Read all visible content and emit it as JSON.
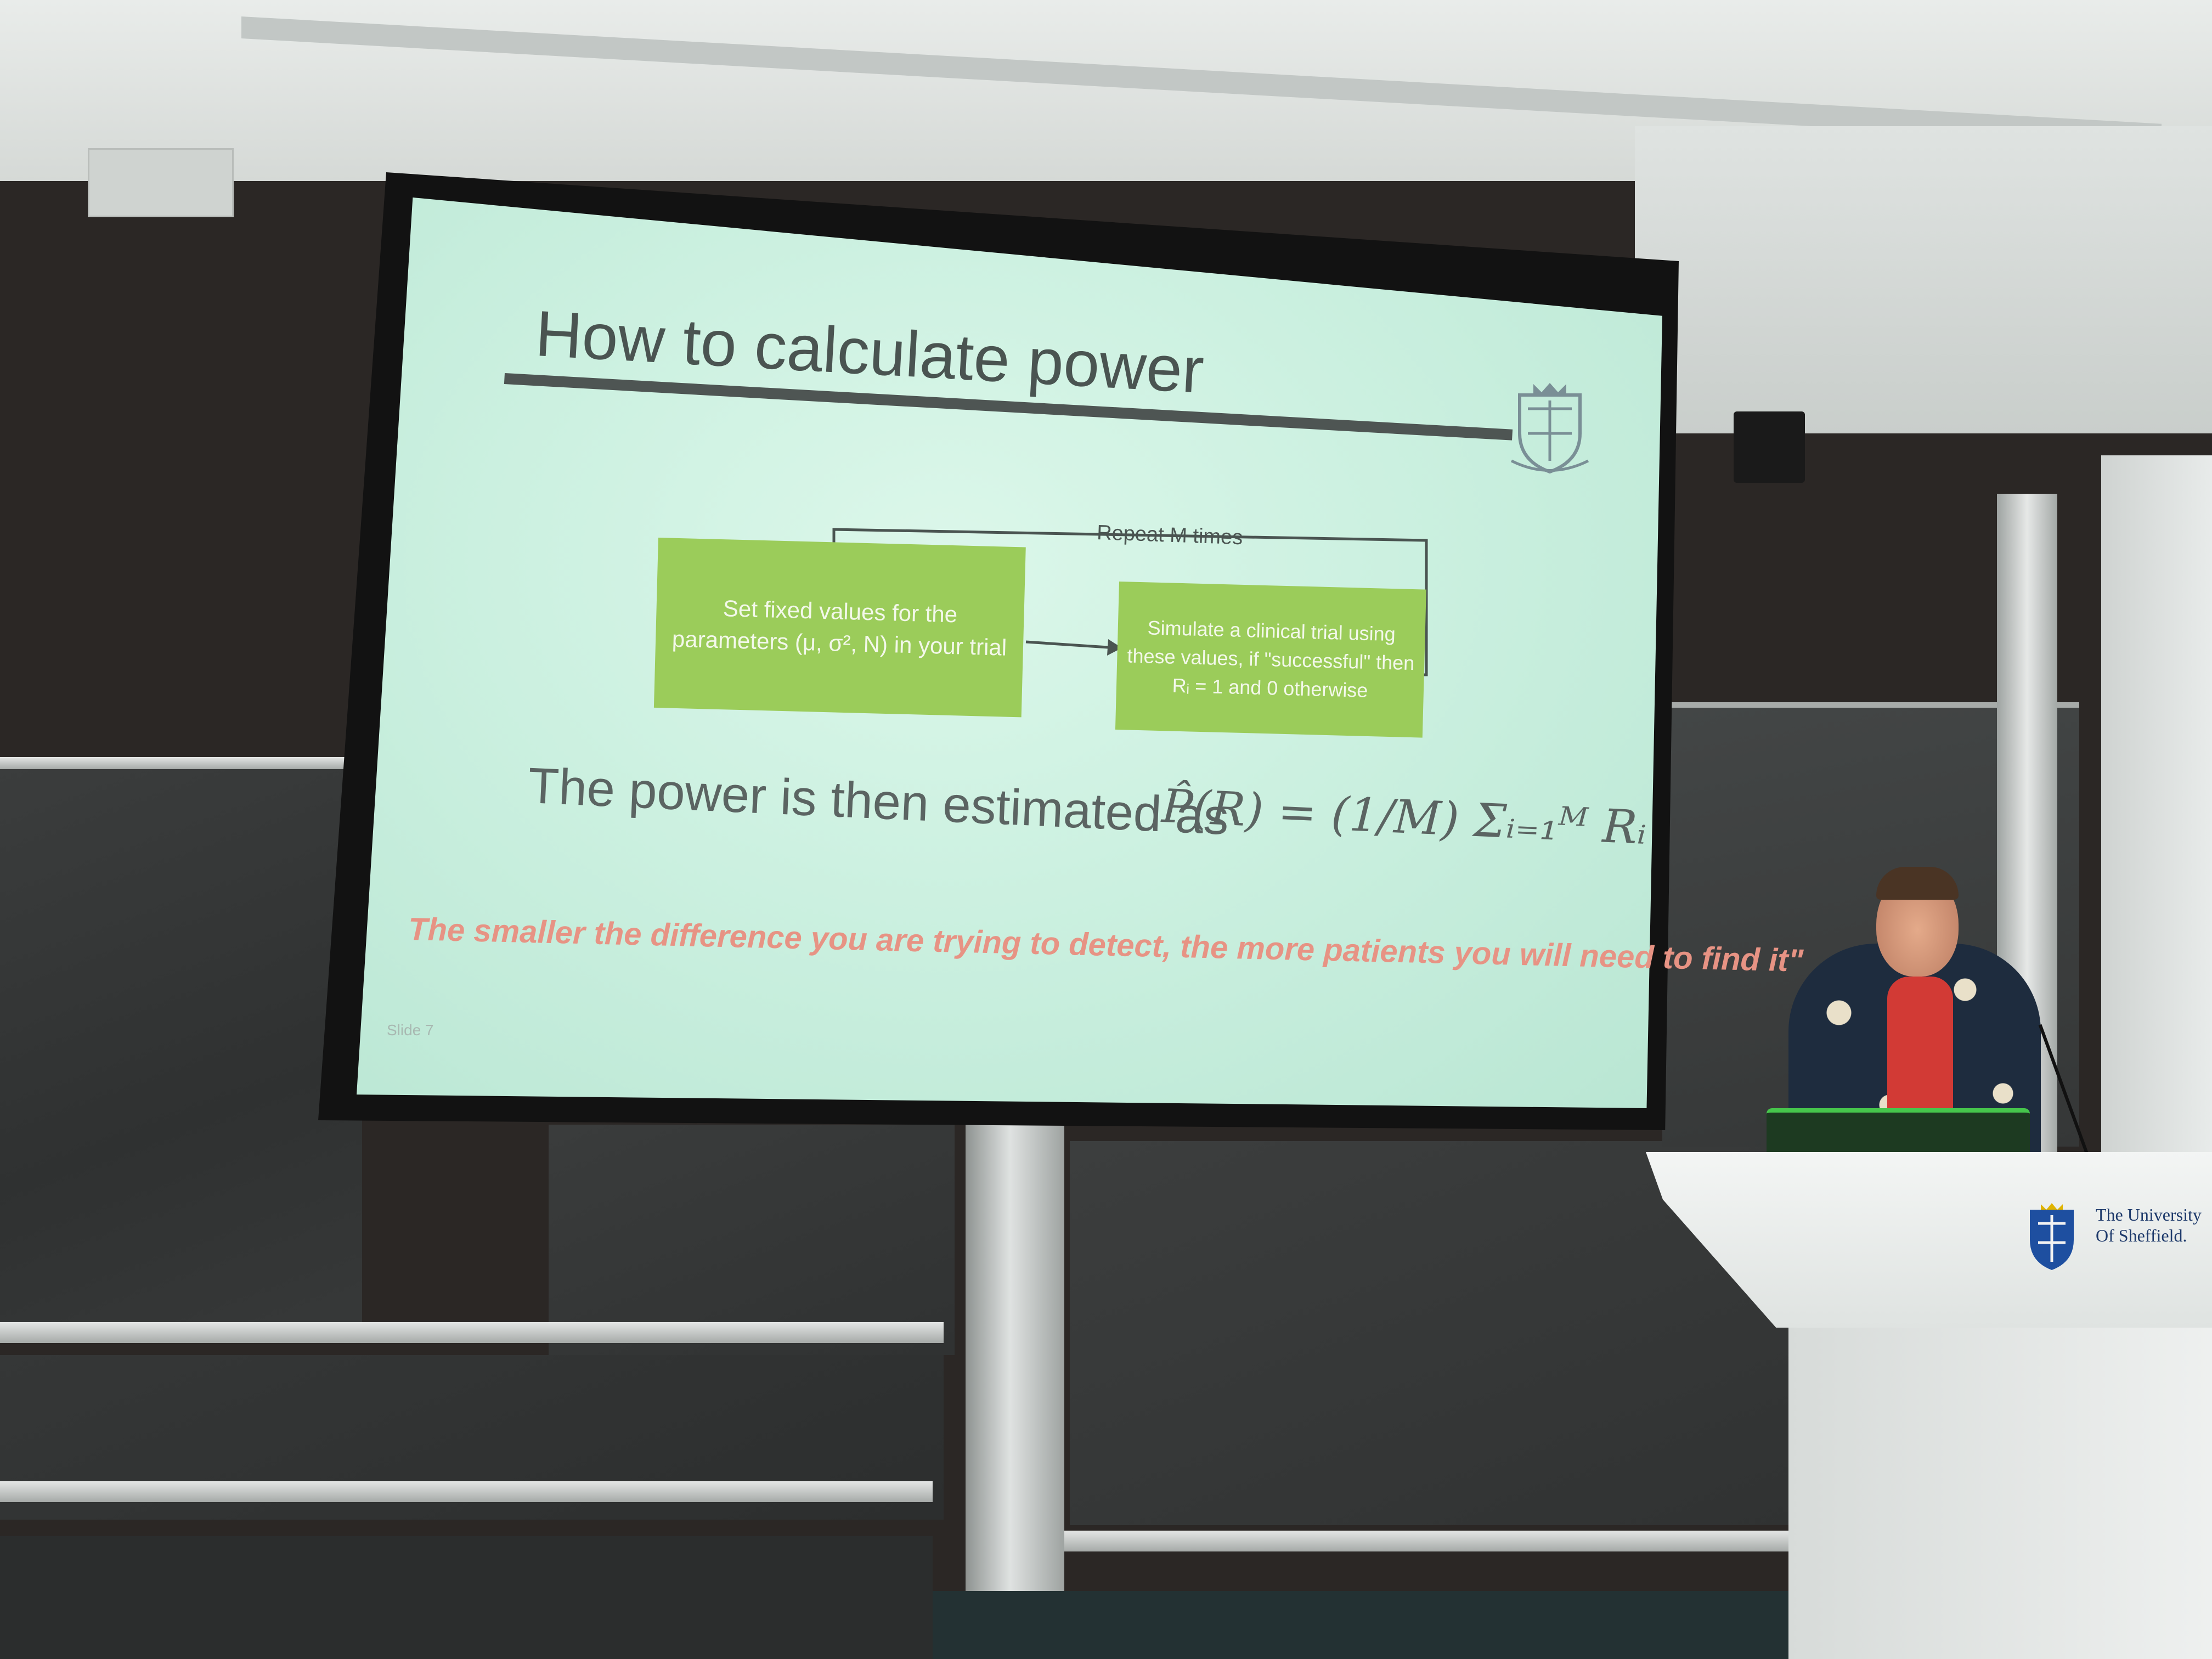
{
  "slide": {
    "title": "How to calculate power",
    "repeat_label": "Repeat M times",
    "box_left": "Set fixed values for the parameters (μ, σ², N) in your trial",
    "box_right": "Simulate a clinical trial using these values, if \"successful\" then Rᵢ = 1 and 0 otherwise",
    "power_text": "The power is then estimated as",
    "formula": "P̂(R) = (1/M) Σᵢ₌₁ᴹ Rᵢ",
    "quote": "The smaller the difference you are trying to detect, the more patients you will need to find it\"",
    "slide_number": "Slide 7"
  },
  "podium": {
    "logo_text": "The University Of Sheffield."
  },
  "colors": {
    "screen_background": "#cdf1e1",
    "box_green": "#9bcc5a",
    "quote_red": "#e79384",
    "title_gray": "#4a5451",
    "podium_blue": "#1e3a6b"
  },
  "icons": [
    "university-crest-icon",
    "podium-logo-icon"
  ]
}
